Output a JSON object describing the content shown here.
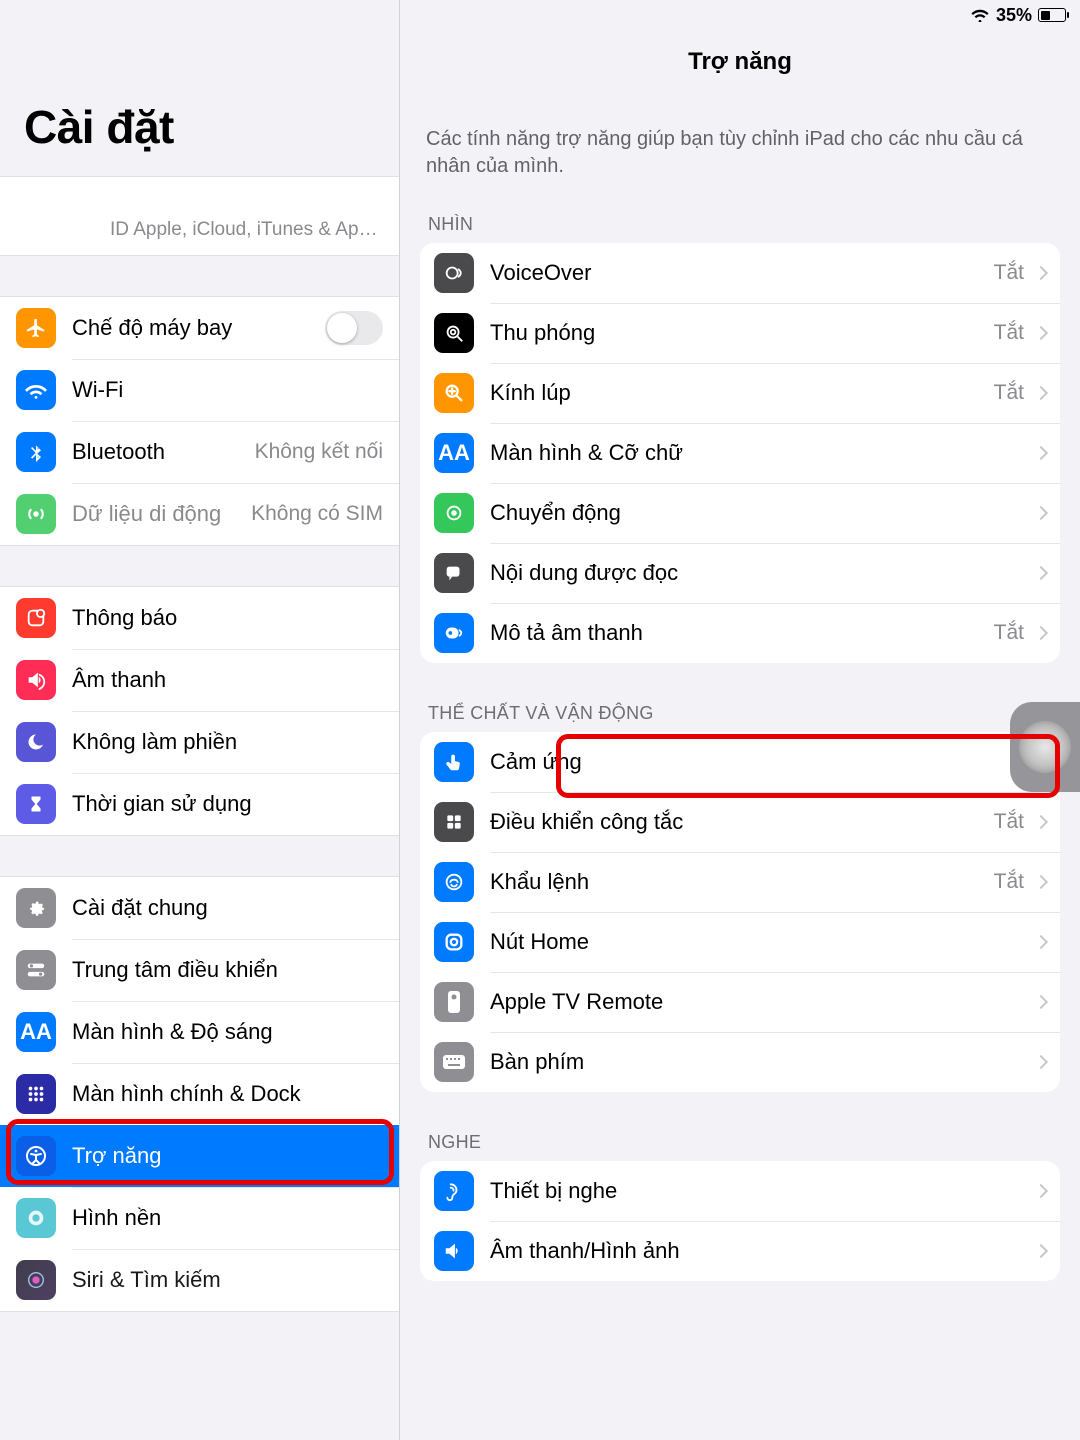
{
  "status": {
    "battery_pct": "35%"
  },
  "sidebar": {
    "title": "Cài đặt",
    "account_sub": "ID Apple, iCloud, iTunes & App St…",
    "rows": {
      "airplane": {
        "label": "Chế độ máy bay"
      },
      "wifi": {
        "label": "Wi-Fi"
      },
      "bluetooth": {
        "label": "Bluetooth",
        "value": "Không kết nối"
      },
      "cellular": {
        "label": "Dữ liệu di động",
        "value": "Không có SIM"
      },
      "notify": {
        "label": "Thông báo"
      },
      "sound": {
        "label": "Âm thanh"
      },
      "dnd": {
        "label": "Không làm phiền"
      },
      "screentime": {
        "label": "Thời gian sử dụng"
      },
      "general": {
        "label": "Cài đặt chung"
      },
      "control": {
        "label": "Trung tâm điều khiển"
      },
      "display": {
        "label": "Màn hình & Độ sáng"
      },
      "home": {
        "label": "Màn hình chính & Dock"
      },
      "accessibility": {
        "label": "Trợ năng"
      },
      "wallpaper": {
        "label": "Hình nền"
      },
      "siri": {
        "label": "Siri & Tìm kiếm"
      }
    }
  },
  "detail": {
    "title": "Trợ năng",
    "intro": "Các tính năng trợ năng giúp bạn tùy chỉnh iPad cho các nhu cầu cá nhân của mình.",
    "off": "Tắt",
    "sections": {
      "vision": {
        "header": "NHÌN"
      },
      "physical": {
        "header": "THỂ CHẤT VÀ VẬN ĐỘNG"
      },
      "hearing": {
        "header": "NGHE"
      }
    },
    "rows": {
      "voiceover": {
        "label": "VoiceOver"
      },
      "zoom": {
        "label": "Thu phóng"
      },
      "magnifier": {
        "label": "Kính lúp"
      },
      "display_text": {
        "label": "Màn hình & Cỡ chữ"
      },
      "motion": {
        "label": "Chuyển động"
      },
      "spoken": {
        "label": "Nội dung được đọc"
      },
      "audio_desc": {
        "label": "Mô tả âm thanh"
      },
      "touch": {
        "label": "Cảm ứng"
      },
      "switch": {
        "label": "Điều khiển công tắc"
      },
      "voice_control": {
        "label": "Khẩu lệnh"
      },
      "home_btn": {
        "label": "Nút Home"
      },
      "apple_tv": {
        "label": "Apple TV Remote"
      },
      "keyboard": {
        "label": "Bàn phím"
      },
      "hearing_dev": {
        "label": "Thiết bị nghe"
      },
      "audio_visual": {
        "label": "Âm thanh/Hình ảnh"
      }
    }
  }
}
